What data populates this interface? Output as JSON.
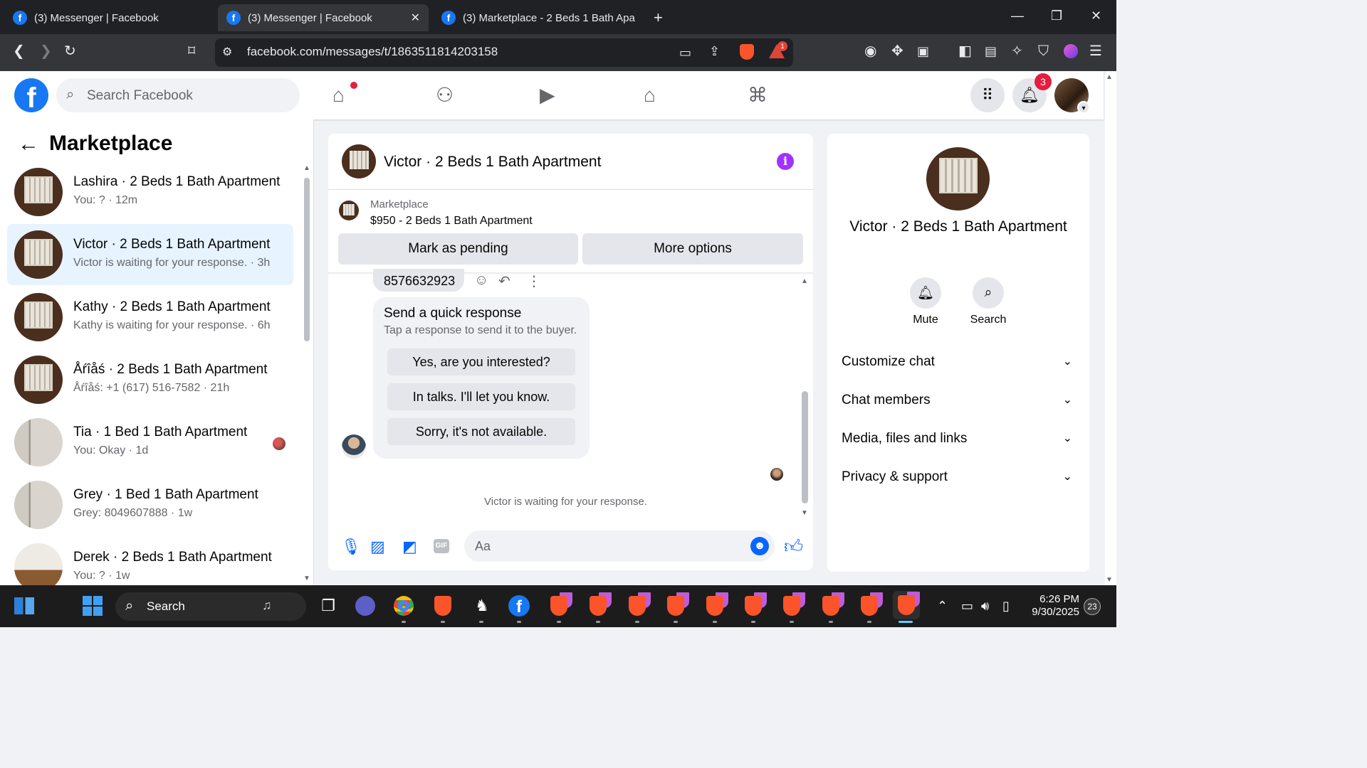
{
  "browser": {
    "tabs": [
      {
        "title": "(3) Messenger | Facebook",
        "active": false
      },
      {
        "title": "(3) Messenger | Facebook",
        "active": true
      },
      {
        "title": "(3) Marketplace - 2 Beds 1 Bath Apart",
        "active": false
      }
    ],
    "url": "facebook.com/messages/t/1863511814203158",
    "rewards_badge": "1"
  },
  "fb_header": {
    "search_placeholder": "Search Facebook",
    "notifications_count": "3"
  },
  "sidebar": {
    "title": "Marketplace",
    "conversations": [
      {
        "name": "Lashira · 2 Beds 1 Bath Apartment",
        "preview": "You: ? · 12m",
        "thumb": "window",
        "selected": false
      },
      {
        "name": "Victor · 2 Beds 1 Bath Apartment",
        "preview": "Victor is waiting for your response. · 3h",
        "thumb": "window",
        "selected": true
      },
      {
        "name": "Kathy · 2 Beds 1 Bath Apartment",
        "preview": "Kathy is waiting for your response. · 6h",
        "thumb": "window",
        "selected": false
      },
      {
        "name": "Åŕîåś · 2 Beds 1 Bath Apartment",
        "preview": "Åŕîåś: +1 (617) 516-7582 · 21h",
        "thumb": "window",
        "selected": false
      },
      {
        "name": "Tia · 1 Bed 1 Bath Apartment",
        "preview": "You: Okay · 1d",
        "thumb": "room",
        "selected": false
      },
      {
        "name": "Grey · 1 Bed 1 Bath Apartment",
        "preview": "Grey: 8049607888 · 1w",
        "thumb": "room",
        "selected": false
      },
      {
        "name": "Derek · 2 Beds 1 Bath Apartment",
        "preview": "You: ? · 1w",
        "thumb": "floor",
        "selected": false
      }
    ]
  },
  "chat": {
    "title": "Victor · 2 Beds 1 Bath Apartment",
    "marketplace_label": "Marketplace",
    "listing": "$950 - 2 Beds 1 Bath Apartment",
    "mark_pending": "Mark as pending",
    "more_options": "More options",
    "phone_message": "8576632923",
    "quick_response": {
      "title": "Send a quick response",
      "subtitle": "Tap a response to send it to the buyer.",
      "options": [
        "Yes, are you interested?",
        "In talks. I'll let you know.",
        "Sorry, it's not available."
      ]
    },
    "waiting_text": "Victor is waiting for your response.",
    "input_placeholder": "Aa",
    "gif_label": "GIF"
  },
  "details": {
    "name": "Victor · 2 Beds 1 Bath Apartment",
    "mute_label": "Mute",
    "search_label": "Search",
    "sections": [
      "Customize chat",
      "Chat members",
      "Media, files and links",
      "Privacy & support"
    ]
  },
  "taskbar": {
    "search_label": "Search",
    "time": "6:26 PM",
    "date": "9/30/2025",
    "notif_count": "23"
  },
  "colors": {
    "fb_blue": "#1877f2",
    "messenger_blue": "#0866ff",
    "info_purple": "#a033ff",
    "selected_bg": "#e7f3ff",
    "badge_red": "#e41e3f"
  }
}
